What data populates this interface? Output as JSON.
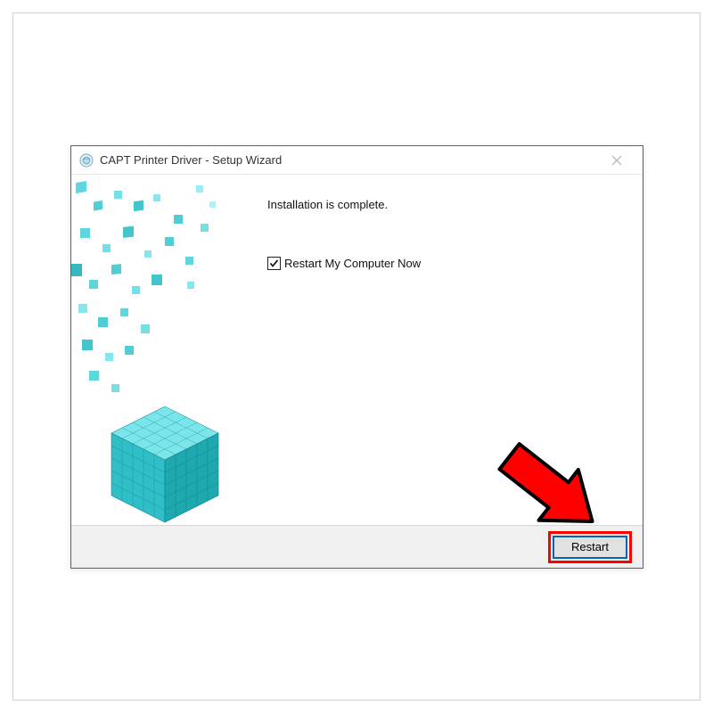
{
  "dialog": {
    "title": "CAPT Printer Driver - Setup Wizard",
    "message": "Installation is complete.",
    "checkbox_label": "Restart My Computer Now",
    "checkbox_checked": true,
    "restart_button": "Restart"
  },
  "annotation": {
    "arrow_color": "#ff0000"
  }
}
